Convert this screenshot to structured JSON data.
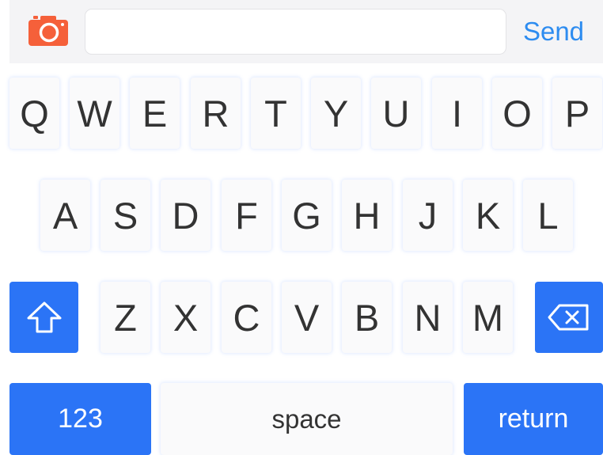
{
  "toolbar": {
    "send_label": "Send",
    "message_value": "",
    "message_placeholder": "",
    "accent_color": "#2d8cf0",
    "camera_icon": "camera-icon",
    "camera_color": "#f5603a"
  },
  "keyboard": {
    "row1": [
      "Q",
      "W",
      "E",
      "R",
      "T",
      "Y",
      "U",
      "I",
      "O",
      "P"
    ],
    "row2": [
      "A",
      "S",
      "D",
      "F",
      "G",
      "H",
      "J",
      "K",
      "L"
    ],
    "row3": [
      "Z",
      "X",
      "C",
      "V",
      "B",
      "N",
      "M"
    ],
    "shift_icon": "shift-arrow-icon",
    "delete_icon": "backspace-icon",
    "numbers_label": "123",
    "space_label": "space",
    "return_label": "return",
    "key_color": "#fafafb",
    "action_key_color": "#2b74f6"
  }
}
